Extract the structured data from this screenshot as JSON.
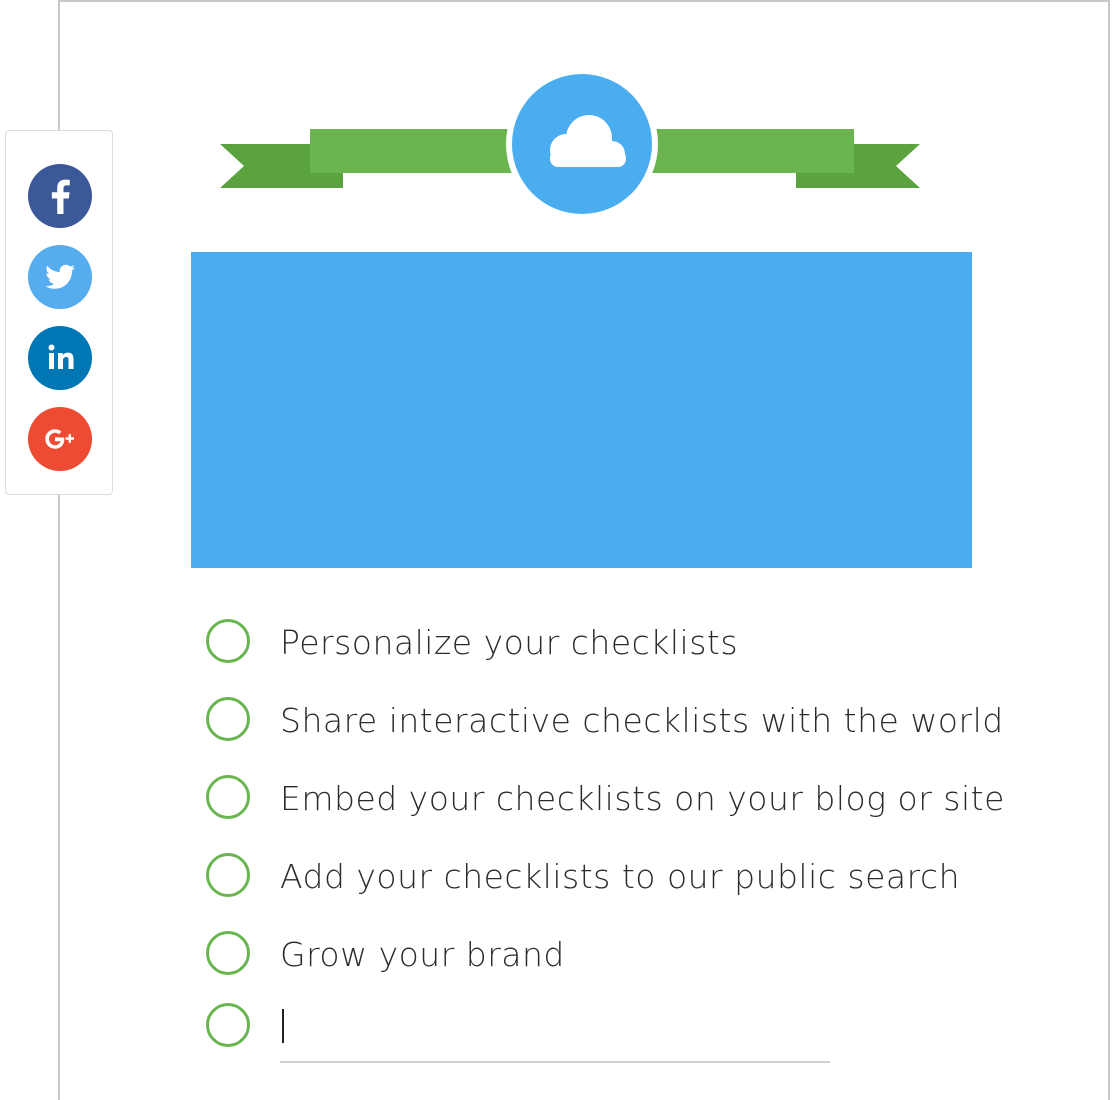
{
  "share": {
    "items": [
      {
        "network": "facebook",
        "icon": "facebook-icon",
        "color": "#3b5998"
      },
      {
        "network": "twitter",
        "icon": "twitter-icon",
        "color": "#55acee"
      },
      {
        "network": "linkedin",
        "icon": "linkedin-icon",
        "color": "#0077b5"
      },
      {
        "network": "google-plus",
        "icon": "google-plus-icon",
        "color": "#ee4b33"
      }
    ]
  },
  "banner": {
    "icon": "cloud-icon",
    "ribbon_color": "#6ab550",
    "ribbon_dark_color": "#5aa33f",
    "badge_color": "#4aadf0"
  },
  "hero": {
    "color": "#4aadf0"
  },
  "checklist": {
    "circle_color": "#6ab550",
    "items": [
      {
        "label": "Personalize your checklists"
      },
      {
        "label": "Share interactive checklists with the world"
      },
      {
        "label": "Embed your checklists on your blog or site"
      },
      {
        "label": "Add your checklists to our public search"
      },
      {
        "label": "Grow your brand"
      }
    ],
    "new_item_value": ""
  }
}
